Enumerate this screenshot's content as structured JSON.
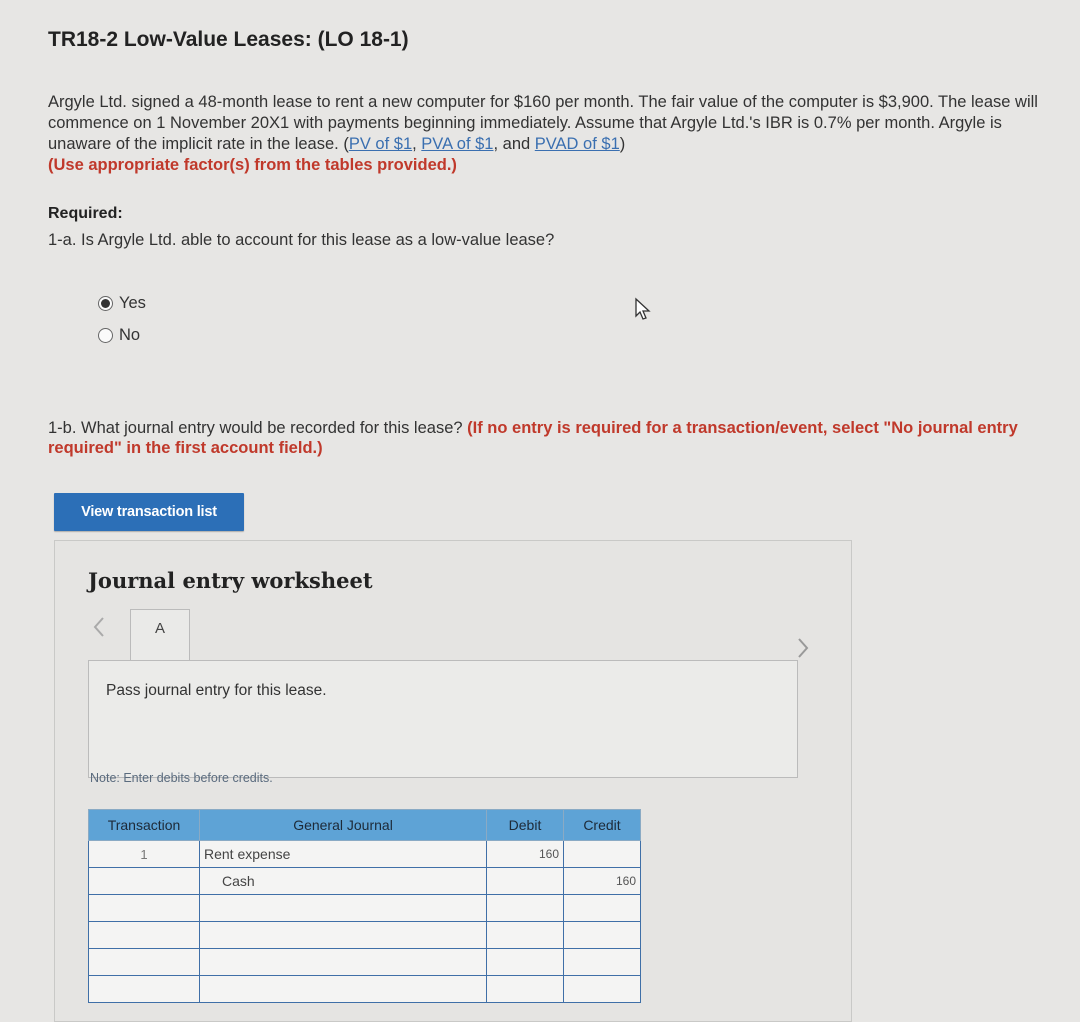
{
  "header": {
    "title": "TR18-2 Low-Value Leases: (LO 18-1)"
  },
  "problem": {
    "text": "Argyle Ltd. signed a 48-month lease to rent a new computer for $160 per month. The fair value of the computer is $3,900. The lease will commence on 1 November 20X1 with payments beginning immediately. Assume that Argyle Ltd.'s IBR is 0.7% per month. Argyle is unaware of the implicit rate in the lease. (",
    "link1": "PV of $1",
    "sep1": ", ",
    "link2": "PVA of $1",
    "sep2": ", and ",
    "link3": "PVAD of $1",
    "sep3": ")",
    "instruction": "(Use appropriate factor(s) from the tables provided.)"
  },
  "required": {
    "heading": "Required:",
    "q1a": "1-a. Is Argyle Ltd. able to account for this lease as a low-value lease?",
    "options": [
      {
        "label": "Yes",
        "selected": true
      },
      {
        "label": "No",
        "selected": false
      }
    ],
    "q1b": "1-b. What journal entry would be recorded for this lease? ",
    "q1b_instruction": "(If no entry is required for a transaction/event, select \"No journal entry required\" in the first account field.)"
  },
  "buttons": {
    "view_transactions": "View transaction list"
  },
  "worksheet": {
    "title": "Journal entry worksheet",
    "tab_label": "A",
    "instruction": "Pass journal entry for this lease.",
    "note": "Note: Enter debits before credits.",
    "columns": [
      "Transaction",
      "General Journal",
      "Debit",
      "Credit"
    ],
    "rows": [
      {
        "transaction": "1",
        "account": "Rent expense",
        "debit": "160",
        "credit": ""
      },
      {
        "transaction": "",
        "account": "Cash",
        "debit": "",
        "credit": "160"
      },
      {
        "transaction": "",
        "account": "",
        "debit": "",
        "credit": ""
      },
      {
        "transaction": "",
        "account": "",
        "debit": "",
        "credit": ""
      },
      {
        "transaction": "",
        "account": "",
        "debit": "",
        "credit": ""
      },
      {
        "transaction": "",
        "account": "",
        "debit": "",
        "credit": ""
      }
    ]
  },
  "colors": {
    "accent": "#2c6fb7",
    "instruction_red": "#c0392b",
    "table_header": "#5ea3d6"
  }
}
